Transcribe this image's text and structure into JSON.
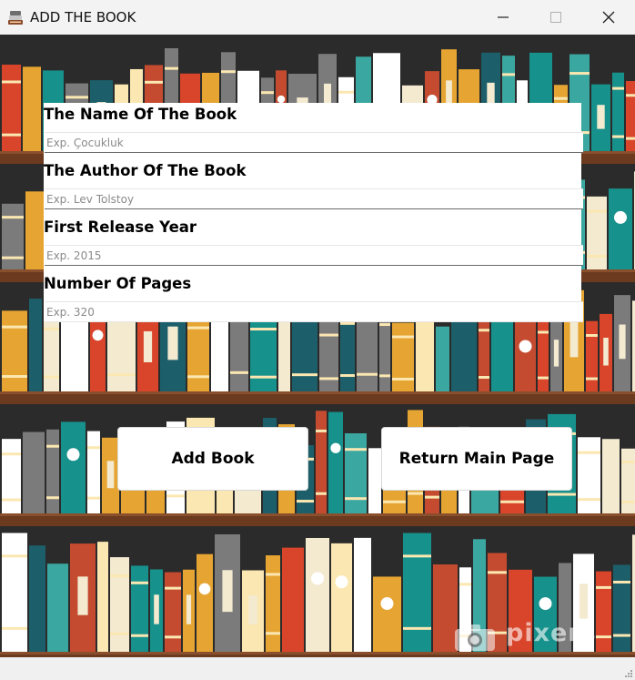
{
  "window": {
    "title": "ADD THE BOOK"
  },
  "colors": {
    "shelf": "#6b3a1f",
    "wall": "#2b2b2b",
    "book": [
      "#e6a532",
      "#d9452b",
      "#17918c",
      "#f3ead0",
      "#7b7b7b",
      "#1c5f6a",
      "#c44b2f",
      "#ffffff",
      "#3ba7a1",
      "#fbe7b1"
    ]
  },
  "form": {
    "fields": [
      {
        "label": "The Name Of The Book",
        "placeholder": "Exp. Çocukluk"
      },
      {
        "label": "The Author Of The Book",
        "placeholder": "Exp. Lev Tolstoy"
      },
      {
        "label": "First Release Year",
        "placeholder": "Exp. 2015"
      },
      {
        "label": "Number Of Pages",
        "placeholder": "Exp. 320"
      }
    ]
  },
  "buttons": {
    "add": "Add Book",
    "return": "Return Main Page"
  },
  "watermark": "pixers"
}
